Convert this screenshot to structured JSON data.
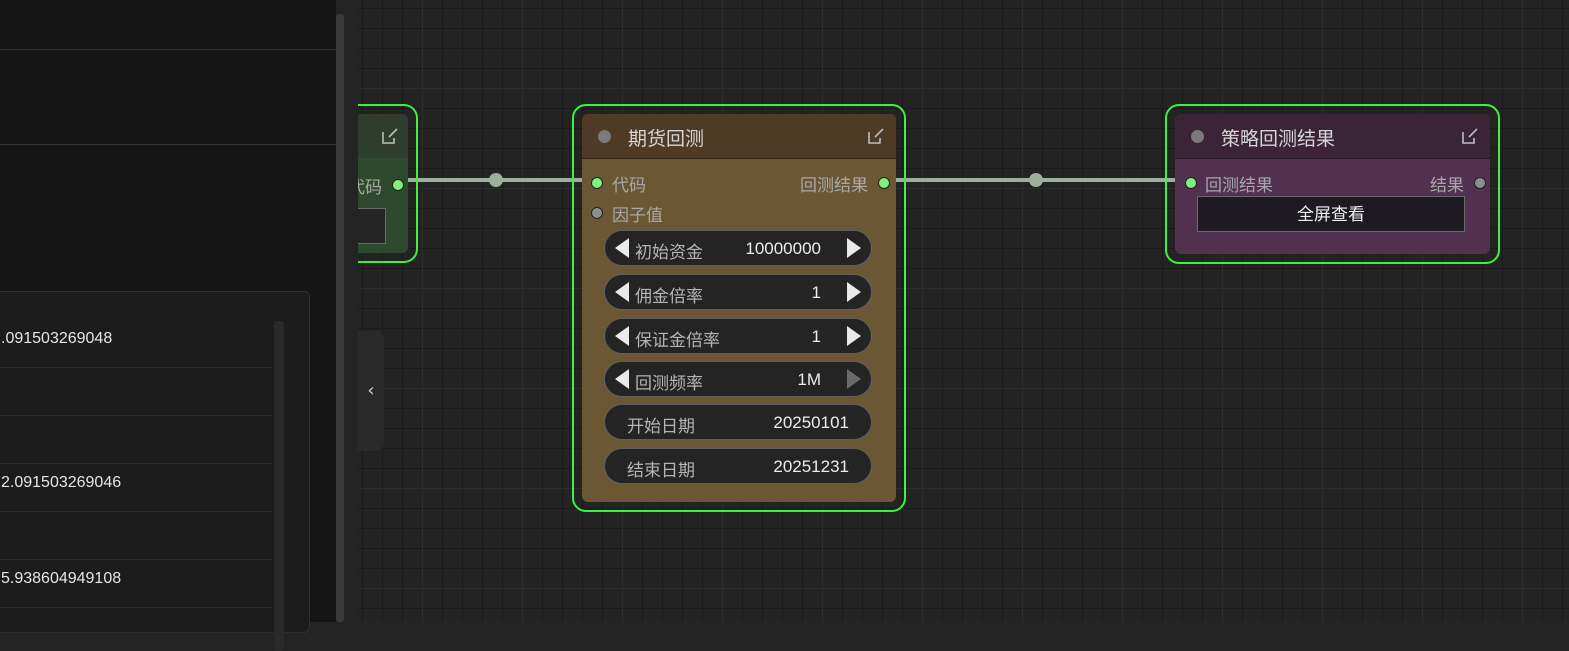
{
  "left_panel": {
    "results": [
      ".091503269048",
      "",
      "",
      "2.091503269046",
      "",
      "5.938604949108"
    ]
  },
  "canvas": {
    "collapse_label": "‹",
    "left_node": {
      "port_out_label": "代码"
    },
    "futures_node": {
      "title": "期货回测",
      "inputs": [
        "代码",
        "因子值"
      ],
      "output": "回测结果",
      "widgets": [
        {
          "label": "初始资金",
          "value": "10000000"
        },
        {
          "label": "佣金倍率",
          "value": "1"
        },
        {
          "label": "保证金倍率",
          "value": "1"
        },
        {
          "label": "回测频率",
          "value": "1M"
        },
        {
          "label": "开始日期",
          "value": "20250101"
        },
        {
          "label": "结束日期",
          "value": "20251231"
        }
      ]
    },
    "result_node": {
      "title": "策略回测结果",
      "input": "回测结果",
      "output": "结果",
      "button": "全屏查看"
    }
  },
  "colors": {
    "selection_border": "#3cf23c",
    "futures_header": "#4f3a26",
    "futures_body": "#6c5735",
    "result_header": "#3a2436",
    "result_body": "#523050",
    "left_node_body": "#2e4a2e",
    "wire": "#9db09d"
  }
}
